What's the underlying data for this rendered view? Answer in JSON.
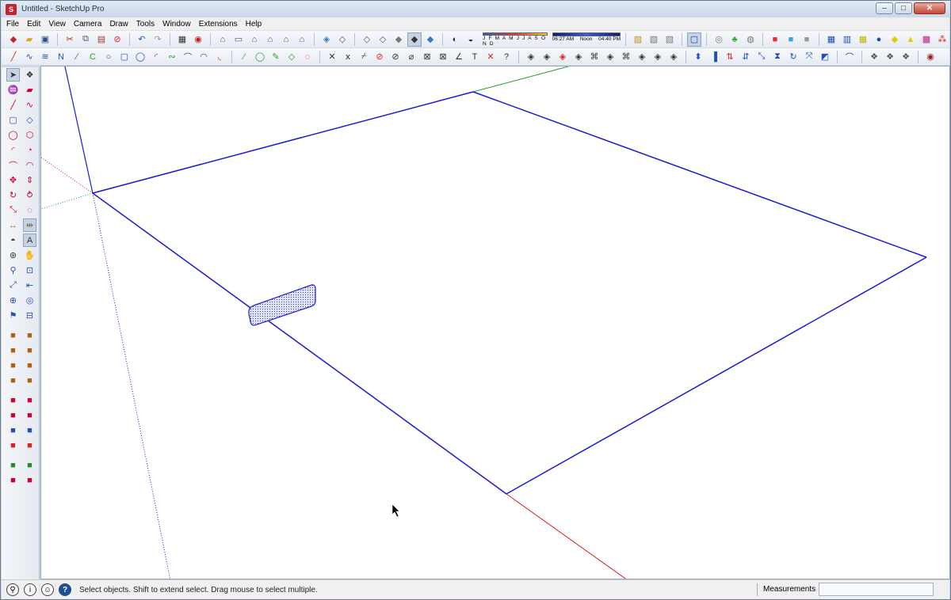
{
  "window": {
    "title": "Untitled - SketchUp Pro",
    "controls": {
      "minimize": "–",
      "maximize": "□",
      "close": "✕"
    }
  },
  "menubar": {
    "items": [
      {
        "label": "File",
        "icon": ""
      },
      {
        "label": "Edit",
        "icon": ""
      },
      {
        "label": "View",
        "icon": ""
      },
      {
        "label": "Camera",
        "icon": ""
      },
      {
        "label": "Draw",
        "icon": ""
      },
      {
        "label": "Tools",
        "icon": ""
      },
      {
        "label": "Window",
        "icon": ""
      },
      {
        "label": "Extensions",
        "icon": ""
      },
      {
        "label": "Help",
        "icon": ""
      }
    ]
  },
  "shadows": {
    "months": "J F M A M J J A S O N D",
    "time_start": "06:27 AM",
    "time_mid": "Noon",
    "time_end": "04:40 PM"
  },
  "statusbar": {
    "message": "Select objects. Shift to extend select. Drag mouse to select multiple.",
    "measurements_label": "Measurements",
    "measurements_value": ""
  },
  "colors": {
    "edge_blue": "#1a1ad6",
    "axis_red": "#d42020",
    "axis_green": "#22a022",
    "axis_blue": "#1a1ad6",
    "face_fill": "#dfe3f5"
  },
  "toolbar1_icons": [
    "new-file-icon",
    "open-folder-icon",
    "save-icon",
    "cut-icon",
    "copy-icon",
    "paste-icon",
    "erase-selection-icon",
    "undo-icon",
    "redo-icon",
    "print-icon",
    "model-info-icon",
    "iso-view-icon",
    "top-view-icon",
    "front-view-icon",
    "right-view-icon",
    "back-view-icon",
    "left-view-icon",
    "xray-icon",
    "back-edges-icon",
    "wireframe-icon",
    "hidden-line-icon",
    "shaded-icon",
    "shaded-texture-icon",
    "monochrome-icon",
    "shadows-toggle-icon",
    "fog-icon"
  ],
  "toolbar1_icons_b": [
    "warehouse-icon",
    "share-model-icon",
    "components-icon",
    "section-icon",
    "layer-icon",
    "solid-icon",
    "sandbox-icon",
    "style-icon",
    "walk-icon",
    "rotate-camera-icon",
    "look-icon",
    "paint-icon",
    "extension-icon",
    "color-grid-icon",
    "grid-icon"
  ],
  "toolbar2_icons": [
    "line-icon",
    "freehand-icon",
    "arc-icon",
    "polyline-icon",
    "arc2-icon",
    "rectangle-icon",
    "circle-icon",
    "polygon-icon",
    "pie-icon",
    "curve-icon",
    "arc3-icon",
    "arc4-icon",
    "spline-icon",
    "bezier-icon",
    "welded-icon",
    "offset-icon",
    "circle2-icon",
    "zorro-icon",
    "intersect-icon",
    "chamfer-icon",
    "fillet-icon",
    "extend-icon",
    "trim-icon",
    "divide-icon",
    "project-icon",
    "explode-icon",
    "help-query-icon",
    "tape-icon",
    "dimension-icon",
    "protractor-icon",
    "text-icon",
    "axes-icon",
    "3d-text-icon",
    "follow-me-icon",
    "push-pull-icon",
    "outer-shell-icon",
    "union-icon",
    "subtract-icon",
    "split-icon",
    "intersect-solid-icon",
    "trim-solid-icon",
    "orbit-icon",
    "pan-icon",
    "zoom-icon",
    "zoom-extents-icon",
    "previous-icon",
    "next-icon",
    "position-camera-icon",
    "walk2-icon",
    "look-around-icon",
    "section2-icon",
    "display-section-icon",
    "section-fill-icon",
    "plugins-icon",
    "sketchup-logo-icon"
  ],
  "left_tools": [
    [
      "select-arrow-icon",
      "make-component-icon"
    ],
    [
      "paint-bucket-icon",
      "eraser-icon"
    ],
    [
      "pencil-line-icon",
      "freehand-icon"
    ],
    [
      "rectangle-icon",
      "rotated-rect-icon"
    ],
    [
      "circle-icon",
      "polygon-icon"
    ],
    [
      "arc-icon",
      "pie-icon"
    ],
    [
      "two-point-arc-icon",
      "three-point-arc-icon"
    ],
    [
      "move-icon",
      "push-pull-icon"
    ],
    [
      "rotate-icon",
      "follow-me-icon"
    ],
    [
      "scale-icon",
      "offset-icon"
    ],
    [
      "tape-measure-icon",
      "dimension-icon"
    ],
    [
      "protractor-icon",
      "text-icon"
    ],
    [
      "orbit-icon",
      "pan-icon"
    ],
    [
      "zoom-icon",
      "zoom-window-icon"
    ],
    [
      "zoom-extents-icon",
      "previous-view-icon"
    ],
    [
      "position-camera-icon",
      "look-around-icon"
    ],
    [
      "walk-icon",
      "section-plane-icon"
    ],
    [
      "sandbox-from-contours-icon",
      "sandbox-from-scratch-icon"
    ],
    [
      "smoove-icon",
      "stamp-icon"
    ],
    [
      "drape-icon",
      "add-detail-icon"
    ],
    [
      "flip-edge-icon",
      "texture-icon"
    ],
    [
      "warehouse-icon",
      "extension-warehouse-icon"
    ],
    [
      "share-model-icon",
      "share-component-icon"
    ],
    [
      "geolocate-icon",
      "photo-texture-icon"
    ],
    [
      "layers-icon",
      "styles-icon"
    ],
    [
      "dynamic-components-icon",
      "component-options-icon"
    ],
    [
      "solid-inspector-icon",
      "sketchup-ruby-icon"
    ]
  ]
}
